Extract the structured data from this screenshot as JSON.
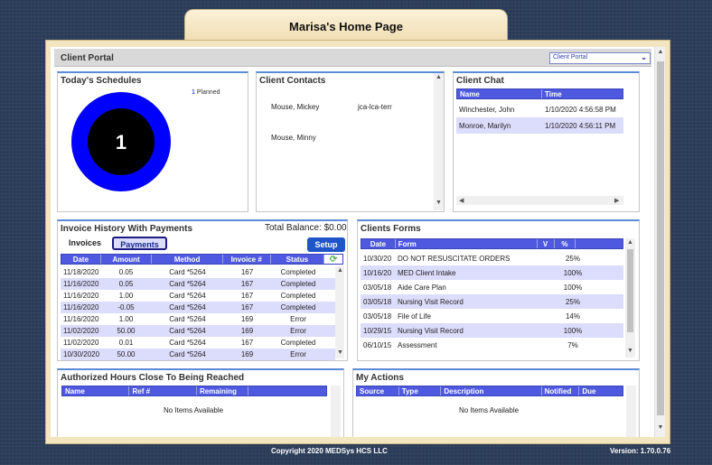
{
  "page_title": "Marisa's Home Page",
  "portal": {
    "label": "Client Portal",
    "select_value": "Client Portal"
  },
  "schedules": {
    "title": "Today's Schedules",
    "count": "1",
    "legend_count": "1",
    "legend_label": "Planned",
    "ring_color": "#0000ff"
  },
  "contacts": {
    "title": "Client Contacts",
    "items": [
      {
        "name": "Mouse, Mickey",
        "code": "jca-lca-terr"
      },
      {
        "name": "Mouse, Minny",
        "code": ""
      }
    ]
  },
  "chat": {
    "title": "Client Chat",
    "columns": [
      "Name",
      "Time"
    ],
    "rows": [
      {
        "name": "Winchester, John",
        "time": "1/10/2020 4:56:58 PM"
      },
      {
        "name": "Monroe, Marilyn",
        "time": "1/10/2020 4:56:11 PM"
      }
    ]
  },
  "invoices": {
    "title": "Invoice History With Payments",
    "total_label": "Total Balance: $0.00",
    "tab_invoices": "Invoices",
    "tab_payments": "Payments",
    "setup_label": "Setup",
    "columns": [
      "Date",
      "Amount",
      "Method",
      "Invoice #",
      "Status"
    ],
    "rows": [
      {
        "date": "11/18/2020",
        "amount": "0.05",
        "method": "Card *5264",
        "invoice": "167",
        "status": "Completed"
      },
      {
        "date": "11/16/2020",
        "amount": "0.05",
        "method": "Card *5264",
        "invoice": "167",
        "status": "Completed"
      },
      {
        "date": "11/16/2020",
        "amount": "1.00",
        "method": "Card *5264",
        "invoice": "167",
        "status": "Completed"
      },
      {
        "date": "11/16/2020",
        "amount": "-0.05",
        "method": "Card *5264",
        "invoice": "167",
        "status": "Completed"
      },
      {
        "date": "11/16/2020",
        "amount": "1.00",
        "method": "Card *5264",
        "invoice": "169",
        "status": "Error"
      },
      {
        "date": "11/02/2020",
        "amount": "50.00",
        "method": "Card *5264",
        "invoice": "169",
        "status": "Error"
      },
      {
        "date": "11/02/2020",
        "amount": "0.01",
        "method": "Card *5264",
        "invoice": "167",
        "status": "Completed"
      },
      {
        "date": "10/30/2020",
        "amount": "50.00",
        "method": "Card *5264",
        "invoice": "169",
        "status": "Error"
      }
    ]
  },
  "forms": {
    "title": "Clients Forms",
    "columns": [
      "Date",
      "Form",
      "V",
      "%"
    ],
    "rows": [
      {
        "date": "10/30/20",
        "form": "DO NOT RESUSCITATE ORDERS",
        "v": "",
        "pct": "25%"
      },
      {
        "date": "10/16/20",
        "form": "MED Client Intake",
        "v": "",
        "pct": "100%"
      },
      {
        "date": "03/05/18",
        "form": "Aide Care Plan",
        "v": "",
        "pct": "100%"
      },
      {
        "date": "03/05/18",
        "form": "Nursing Visit Record",
        "v": "",
        "pct": "25%"
      },
      {
        "date": "03/05/18",
        "form": "File of Life",
        "v": "",
        "pct": "14%"
      },
      {
        "date": "10/29/15",
        "form": "Nursing Visit Record",
        "v": "",
        "pct": "100%"
      },
      {
        "date": "06/10/15",
        "form": "Assessment",
        "v": "",
        "pct": "7%"
      }
    ]
  },
  "auth_hours": {
    "title": "Authorized Hours Close To Being Reached",
    "columns": [
      "Name",
      "Ref #",
      "Remaining"
    ],
    "empty": "No Items Available"
  },
  "actions": {
    "title": "My Actions",
    "columns": [
      "Source",
      "Type",
      "Description",
      "Notified",
      "Due"
    ],
    "empty": "No Items Available"
  },
  "footer": {
    "copyright": "Copyright 2020 MEDSys HCS LLC",
    "version": "Version: 1.70.0.76"
  }
}
